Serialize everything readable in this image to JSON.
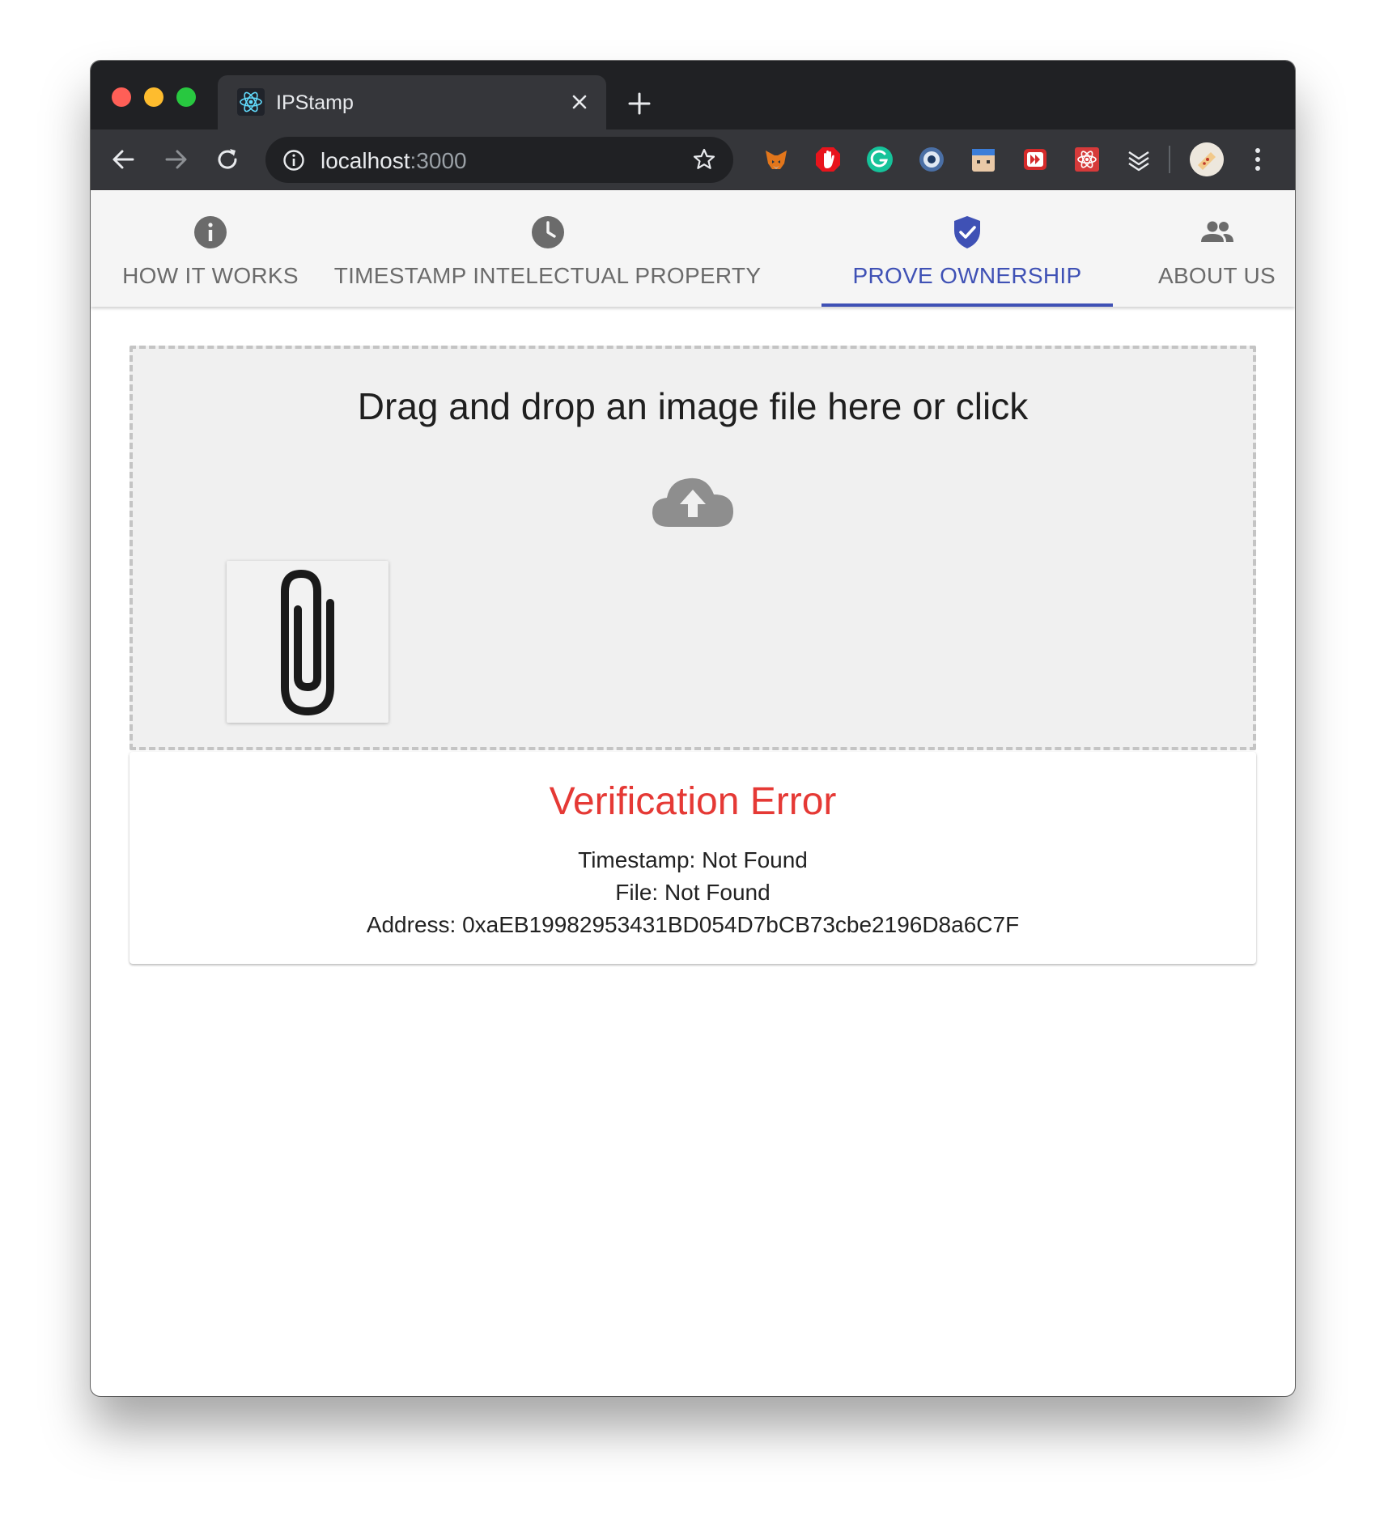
{
  "browser": {
    "tab_title": "IPStamp",
    "url_host": "localhost",
    "url_port": ":3000"
  },
  "nav_tabs": [
    {
      "label": "HOW IT WORKS",
      "icon": "info-icon",
      "active": false
    },
    {
      "label": "TIMESTAMP INTELECTUAL PROPERTY",
      "icon": "clock-icon",
      "active": false
    },
    {
      "label": "PROVE OWNERSHIP",
      "icon": "verified-shield-icon",
      "active": true
    },
    {
      "label": "ABOUT US",
      "icon": "people-icon",
      "active": false
    }
  ],
  "dropzone": {
    "text": "Drag and drop an image file here or click",
    "icon": "cloud-upload-icon",
    "preview_icon": "paperclip-icon"
  },
  "result": {
    "title": "Verification Error",
    "timestamp_line": "Timestamp: Not Found",
    "file_line": "File: Not Found",
    "address_line": "Address: 0xaEB19982953431BD054D7bCB73cbe2196D8a6C7F"
  },
  "colors": {
    "accent": "#3f51b5",
    "error": "#e53935",
    "tab_icon_gray": "#6b6b6b"
  }
}
